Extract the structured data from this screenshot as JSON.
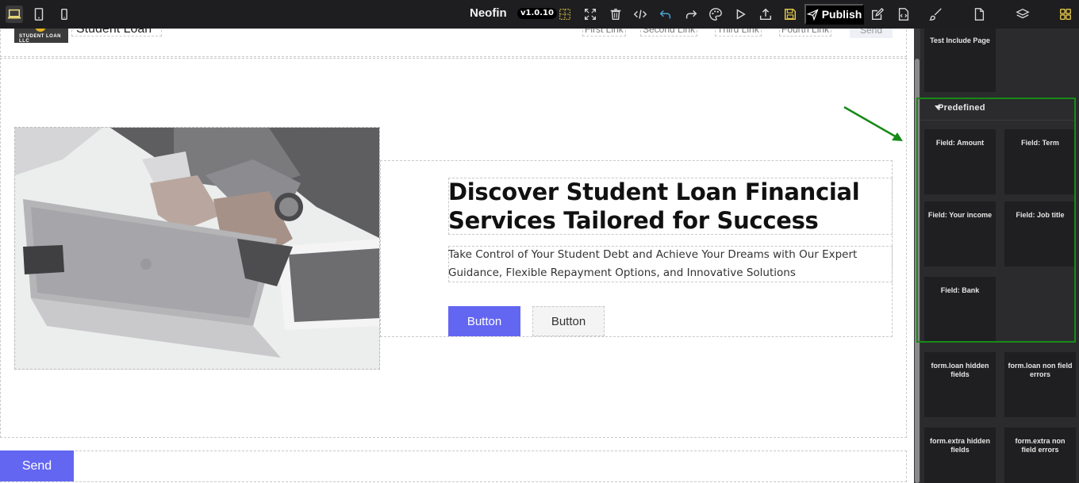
{
  "toolbar": {
    "brand": "Neofin",
    "version": "v1.0.10",
    "publish_label": "Publish"
  },
  "page": {
    "brand_name": "Student Loan",
    "logo_text": "STUDENT LOAN LLC",
    "nav_links": [
      "First Link",
      "Second Link",
      "Third Link",
      "Fourth Link"
    ],
    "nav_send": "Send",
    "headline": "Discover Student Loan Financial Services Tailored for Success",
    "subtext": "Take Control of Your Student Debt and Achieve Your Dreams with Our Expert Guidance, Flexible Repayment Options, and Innovative Solutions",
    "primary_button": "Button",
    "secondary_button": "Button",
    "send_button": "Send"
  },
  "panel": {
    "top_block": "Test Include Page",
    "category": "Predefined",
    "predefined": [
      "Field: Amount",
      "Field: Term",
      "Field: Your income",
      "Field: Job title",
      "Field: Bank"
    ],
    "other_blocks": [
      "form.loan hidden fields",
      "form.loan non field errors",
      "form.extra hidden fields",
      "form.extra non field errors"
    ]
  },
  "colors": {
    "accent": "#6366f1",
    "highlight": "#178a17",
    "active_icon": "#f3e27a"
  }
}
